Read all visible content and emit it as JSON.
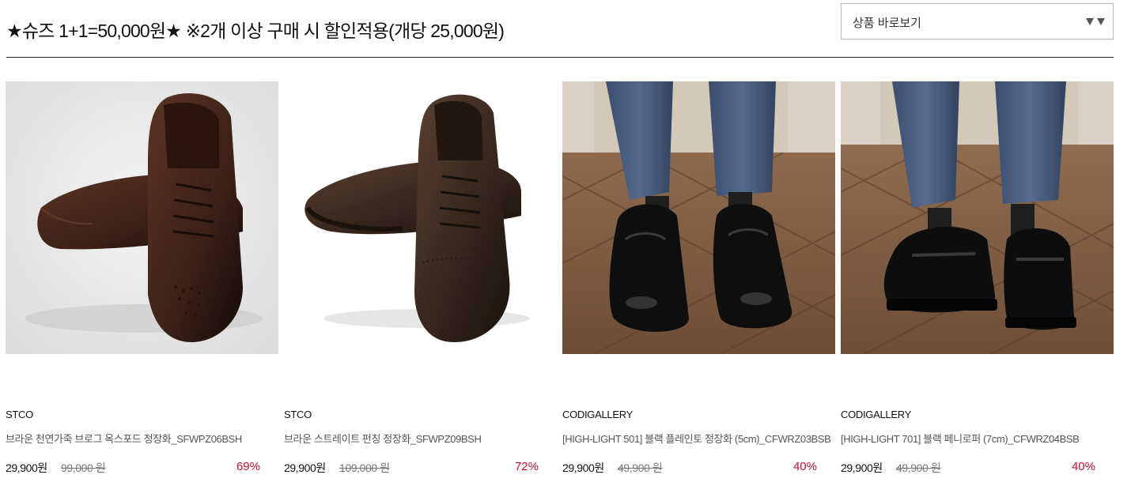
{
  "header": {
    "promo_title": "★슈즈 1+1=50,000원★ ※2개 이상 구매 시 할인적용(개당 25,000원)",
    "select": {
      "label": "상품 바로보기",
      "arrow_icon": "triangle-down-icon"
    }
  },
  "colors": {
    "discount": "#c8102e",
    "border": "#222222"
  },
  "products": [
    {
      "brand": "STCO",
      "name": "브라운 천연가죽 브로그 옥스포드 정장화_SFWPZ06BSH",
      "price": "29,900원",
      "original_price": "99,000 원",
      "discount": "69%"
    },
    {
      "brand": "STCO",
      "name": "브라운 스트레이트 펀칭 정장화_SFWPZ09BSH",
      "price": "29,900원",
      "original_price": "109,000 원",
      "discount": "72%"
    },
    {
      "brand": "CODIGALLERY",
      "name": "[HIGH-LIGHT 501] 블랙 플레인토 정장화 (5cm)_CFWRZ03BSB",
      "price": "29,900원",
      "original_price": "49,900 원",
      "discount": "40%"
    },
    {
      "brand": "CODIGALLERY",
      "name": "[HIGH-LIGHT 701] 블랙 페니로퍼 (7cm)_CFWRZ04BSB",
      "price": "29,900원",
      "original_price": "49,900 원",
      "discount": "40%"
    }
  ]
}
